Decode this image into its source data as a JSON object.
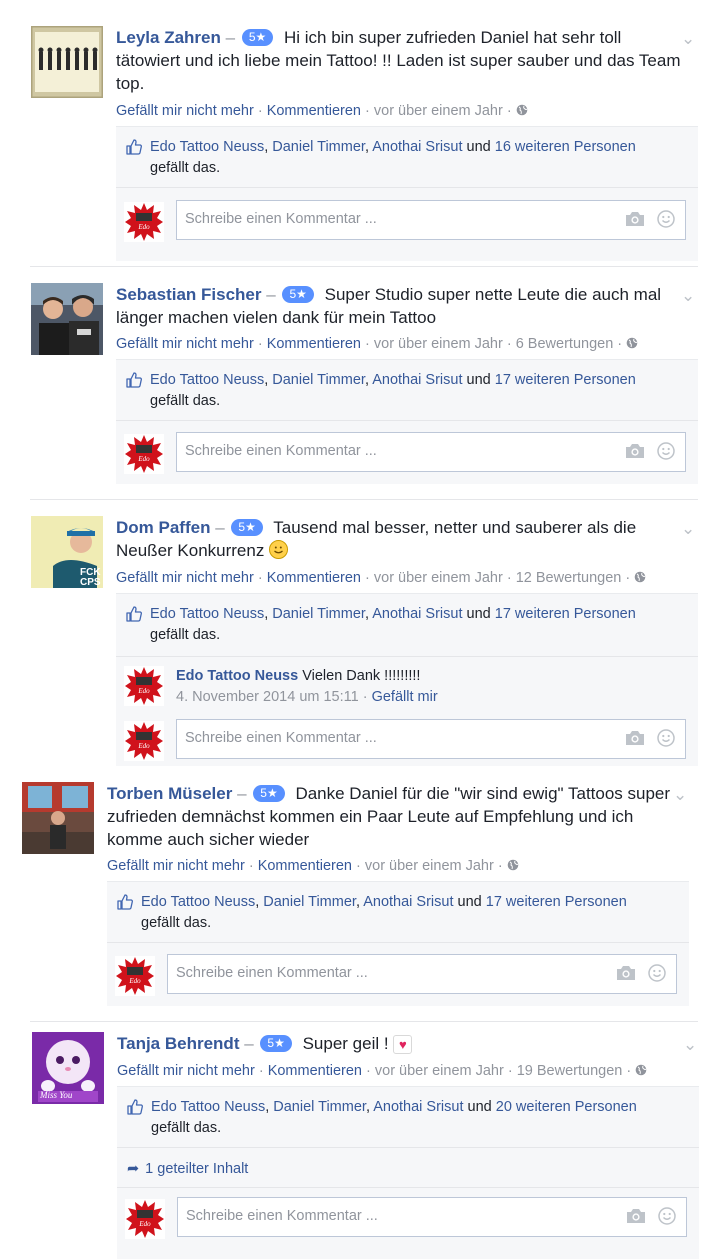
{
  "reviews": [
    {
      "name": "Leyla Zahren",
      "dash": "–",
      "rating": "5★",
      "text": "Hi ich bin super zufrieden Daniel hat sehr toll tätowiert und ich liebe mein Tattoo! !! Laden ist super sauber und das Team top.",
      "meta": {
        "unlike": "Gefällt mir nicht mehr",
        "comment": "Kommentieren",
        "time": "vor über einem Jahr",
        "reviews": ""
      },
      "likes": {
        "p1": "Edo Tattoo Neuss",
        "p2": "Daniel Timmer",
        "p3": "Anothai Srisut",
        "und": "und",
        "others": "16 weiteren Personen",
        "suffix": "gefällt das."
      },
      "comment_placeholder": "Schreibe einen Kommentar ..."
    },
    {
      "name": "Sebastian Fischer",
      "dash": "–",
      "rating": "5★",
      "text": "Super Studio super nette Leute die auch mal länger machen vielen dank für mein Tattoo",
      "meta": {
        "unlike": "Gefällt mir nicht mehr",
        "comment": "Kommentieren",
        "time": "vor über einem Jahr",
        "reviews": "6 Bewertungen"
      },
      "likes": {
        "p1": "Edo Tattoo Neuss",
        "p2": "Daniel Timmer",
        "p3": "Anothai Srisut",
        "und": "und",
        "others": "17 weiteren Personen",
        "suffix": "gefällt das."
      },
      "comment_placeholder": "Schreibe einen Kommentar ..."
    },
    {
      "name": "Dom Paffen",
      "dash": "–",
      "rating": "5★",
      "text": "Tausend mal besser, netter und sauberer als die Neußer Konkurrenz",
      "meta": {
        "unlike": "Gefällt mir nicht mehr",
        "comment": "Kommentieren",
        "time": "vor über einem Jahr",
        "reviews": "12 Bewertungen"
      },
      "likes": {
        "p1": "Edo Tattoo Neuss",
        "p2": "Daniel Timmer",
        "p3": "Anothai Srisut",
        "und": "und",
        "others": "17 weiteren Personen",
        "suffix": "gefällt das."
      },
      "reply": {
        "name": "Edo Tattoo Neuss",
        "text": "Vielen Dank !!!!!!!!!",
        "time": "4. November 2014 um 15:11",
        "like": "Gefällt mir"
      },
      "comment_placeholder": "Schreibe einen Kommentar ..."
    },
    {
      "name": "Torben Müseler",
      "dash": "–",
      "rating": "5★",
      "text": "Danke Daniel für die \"wir sind ewig\" Tattoos super zufrieden demnächst kommen ein Paar Leute auf Empfehlung und ich komme auch sicher wieder",
      "meta": {
        "unlike": "Gefällt mir nicht mehr",
        "comment": "Kommentieren",
        "time": "vor über einem Jahr",
        "reviews": ""
      },
      "likes": {
        "p1": "Edo Tattoo Neuss",
        "p2": "Daniel Timmer",
        "p3": "Anothai Srisut",
        "und": "und",
        "others": "17 weiteren Personen",
        "suffix": "gefällt das."
      },
      "comment_placeholder": "Schreibe einen Kommentar ..."
    },
    {
      "name": "Tanja Behrendt",
      "dash": "–",
      "rating": "5★",
      "text": "Super geil !",
      "meta": {
        "unlike": "Gefällt mir nicht mehr",
        "comment": "Kommentieren",
        "time": "vor über einem Jahr",
        "reviews": "19 Bewertungen"
      },
      "likes": {
        "p1": "Edo Tattoo Neuss",
        "p2": "Daniel Timmer",
        "p3": "Anothai Srisut",
        "und": "und",
        "others": "20 weiteren Personen",
        "suffix": "gefällt das."
      },
      "shared": "1 geteilter Inhalt",
      "comment_placeholder": "Schreibe einen Kommentar ..."
    }
  ],
  "avatar_image_text": "Miss You",
  "colors": {
    "link": "#365899",
    "badge": "#5890ff",
    "muted": "#90949c",
    "panel": "#f6f7f9"
  }
}
